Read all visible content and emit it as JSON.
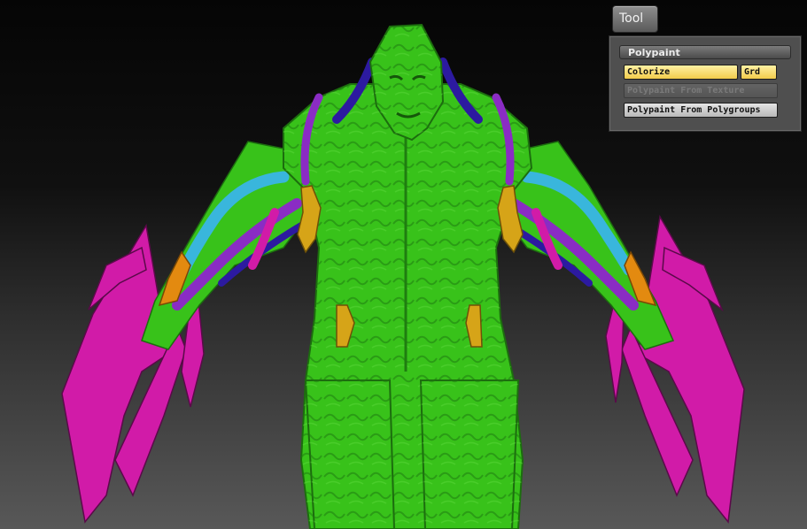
{
  "tool_tab": {
    "label": "Tool"
  },
  "polypaint_panel": {
    "title": "Polypaint",
    "colorize_label": "Colorize",
    "grd_label": "Grd",
    "from_texture_label": "Polypaint From Texture",
    "from_polygroups_label": "Polypaint From Polygroups"
  },
  "colors": {
    "model_green": "#38c21a",
    "polygroup_magenta": "#d11ba8",
    "polygroup_cyan": "#39b6dc",
    "polygroup_purple": "#8a2cc4",
    "polygroup_navy": "#2c1aa0",
    "polygroup_orange": "#e38a10",
    "polygroup_gold": "#d6a418",
    "button_active": "#f6d25a"
  }
}
